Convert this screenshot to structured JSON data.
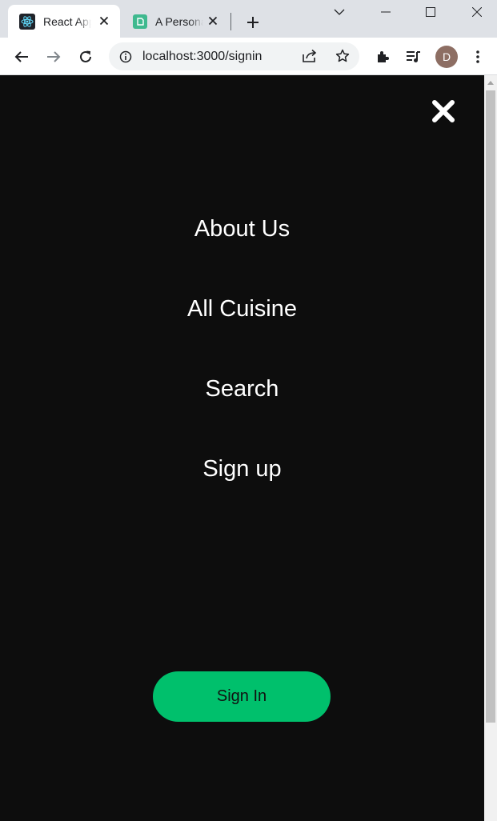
{
  "browser": {
    "tabs": [
      {
        "title": "React App",
        "active": true,
        "favicon": "react-logo-icon"
      },
      {
        "title": "A Personal",
        "active": false,
        "favicon": "app-favicon-icon"
      }
    ],
    "address": "localhost:3000/signin",
    "profile_initial": "D"
  },
  "menu": {
    "items": [
      {
        "label": "About Us"
      },
      {
        "label": "All Cuisine"
      },
      {
        "label": "Search"
      },
      {
        "label": "Sign up"
      }
    ],
    "signin_label": "Sign In"
  },
  "colors": {
    "page_background": "#0d0d0d",
    "accent": "#00c06c",
    "menu_text": "#ffffff"
  }
}
